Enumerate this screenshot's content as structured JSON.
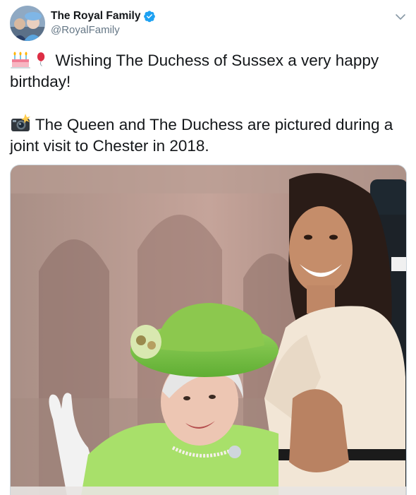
{
  "tweet": {
    "display_name": "The Royal Family",
    "handle": "@RoyalFamily",
    "verified": true,
    "icons": {
      "avatar": "avatar-photo",
      "verified": "verified-badge-icon",
      "menu": "chevron-down-icon",
      "emoji_cake": "birthday-cake-emoji",
      "emoji_balloon": "balloon-emoji",
      "emoji_camera": "camera-flash-emoji"
    },
    "text_line_1": "Wishing The Duchess of Sussex a very happy",
    "text_line_2": "birthday!",
    "text_line_3": "The Queen and The Duchess are pictured during a",
    "text_line_4": "joint visit to Chester in 2018.",
    "colors": {
      "verified": "#1da1f2",
      "handle": "#657786",
      "text": "#14171a"
    }
  }
}
